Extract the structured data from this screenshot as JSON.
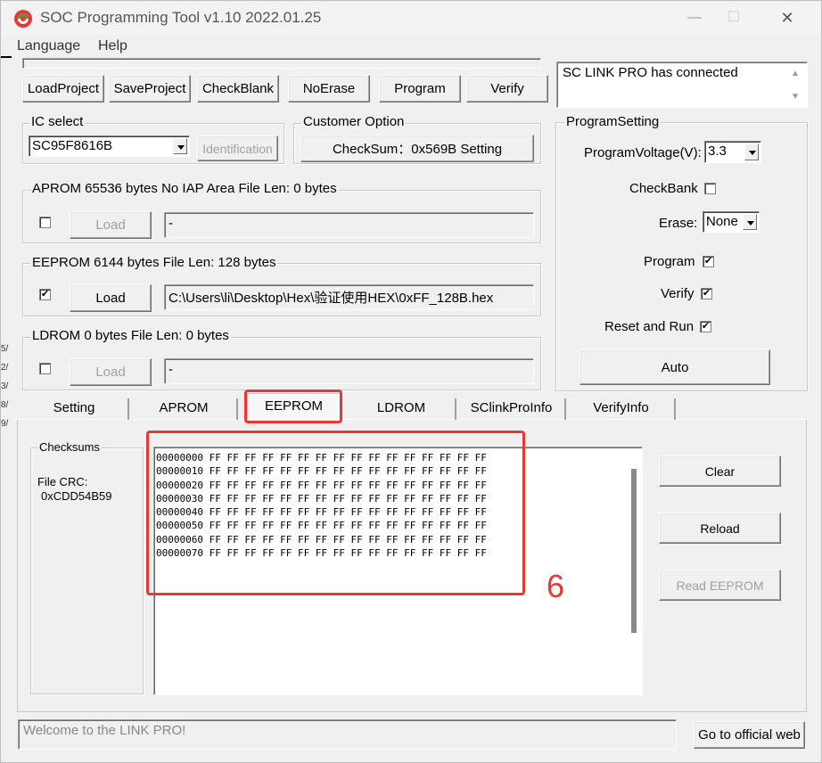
{
  "window": {
    "title": "SOC Programming Tool v1.10 2022.01.25",
    "minimize": "—",
    "maximize": "☐",
    "close": "✕"
  },
  "menu": {
    "language": "Language",
    "help": "Help"
  },
  "toolbar": {
    "load_project": "LoadProject",
    "save_project": "SaveProject",
    "check_blank": "CheckBlank",
    "no_erase": "NoErase",
    "program": "Program",
    "verify": "Verify"
  },
  "status_box": {
    "text": "SC LINK PRO has connected"
  },
  "ic_select": {
    "label": "IC select",
    "value": "SC95F8616B",
    "identification": "Identification"
  },
  "customer_option": {
    "label": "Customer Option",
    "button": "CheckSum：0x569B  Setting"
  },
  "aprom": {
    "label": "APROM 65536 bytes  No IAP Area    File Len: 0 bytes",
    "load": "Load",
    "path": "-",
    "checked": false
  },
  "eeprom": {
    "label": "EEPROM 6144 bytes    File Len: 128 bytes",
    "load": "Load",
    "path": "C:\\Users\\li\\Desktop\\Hex\\验证使用HEX\\0xFF_128B.hex",
    "checked": true
  },
  "ldrom": {
    "label": "LDROM 0 bytes    File Len: 0 bytes",
    "load": "Load",
    "path": "-",
    "checked": false
  },
  "program_setting": {
    "label": "ProgramSetting",
    "voltage_label": "ProgramVoltage(V):",
    "voltage_value": "3.3",
    "checkbank_label": "CheckBank",
    "checkbank_checked": false,
    "erase_label": "Erase:",
    "erase_value": "None",
    "program_label": "Program",
    "program_checked": true,
    "verify_label": "Verify",
    "verify_checked": true,
    "reset_label": "Reset and Run",
    "reset_checked": true,
    "auto": "Auto"
  },
  "tabs": [
    "Setting",
    "APROM",
    "EEPROM",
    "LDROM",
    "SClinkProInfo",
    "VerifyInfo"
  ],
  "active_tab": "EEPROM",
  "checksums": {
    "label": "Checksums",
    "crc_label": "File CRC:",
    "crc_value": "0xCDD54B59"
  },
  "hex_view": {
    "lines": [
      "00000000 FF FF FF FF FF FF FF FF FF FF FF FF FF FF FF FF",
      "00000010 FF FF FF FF FF FF FF FF FF FF FF FF FF FF FF FF",
      "00000020 FF FF FF FF FF FF FF FF FF FF FF FF FF FF FF FF",
      "00000030 FF FF FF FF FF FF FF FF FF FF FF FF FF FF FF FF",
      "00000040 FF FF FF FF FF FF FF FF FF FF FF FF FF FF FF FF",
      "00000050 FF FF FF FF FF FF FF FF FF FF FF FF FF FF FF FF",
      "00000060 FF FF FF FF FF FF FF FF FF FF FF FF FF FF FF FF",
      "00000070 FF FF FF FF FF FF FF FF FF FF FF FF FF FF FF FF"
    ]
  },
  "eeprom_actions": {
    "clear": "Clear",
    "reload": "Reload",
    "read": "Read EEPROM"
  },
  "annotation": {
    "number": "6",
    "color": "#e53935"
  },
  "statusbar": {
    "message": "Welcome to the LINK PRO!",
    "official_web": "Go to official web"
  },
  "left_edge_fragments": [
    "5/",
    "2/",
    "3/",
    "8/",
    "9/"
  ]
}
